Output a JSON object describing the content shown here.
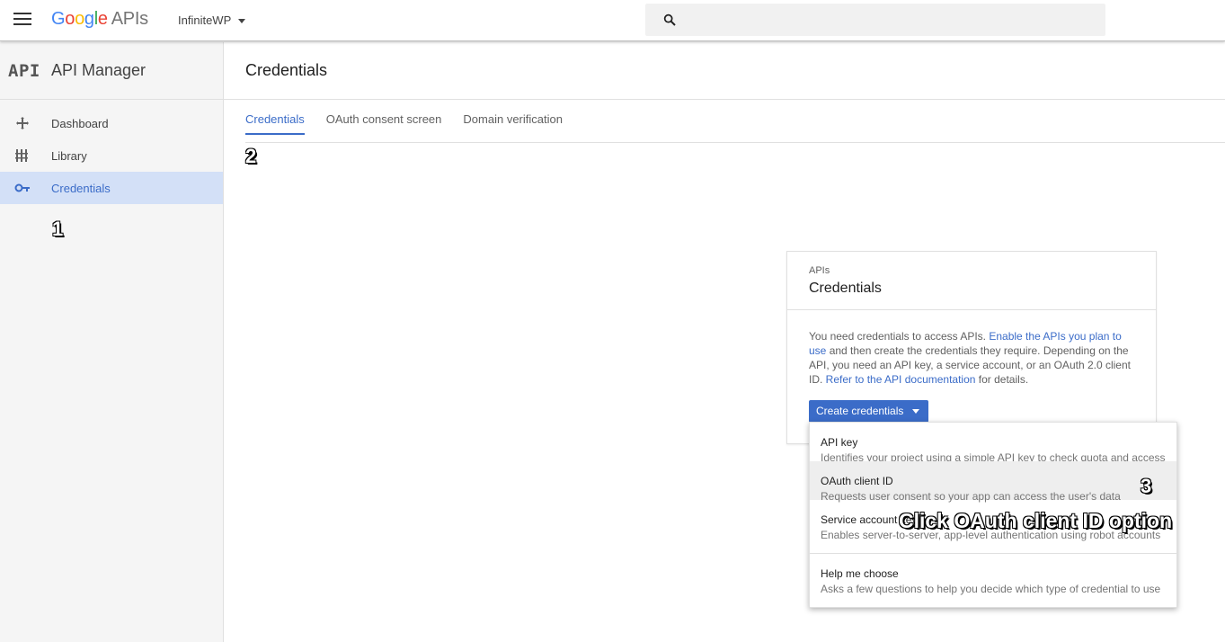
{
  "header": {
    "logo_text": "Google",
    "logo_product": "APIs",
    "project": "InfiniteWP",
    "search_placeholder": ""
  },
  "sidebar": {
    "badge": "API",
    "title": "API Manager",
    "items": [
      {
        "label": "Dashboard",
        "icon": "dashboard-icon"
      },
      {
        "label": "Library",
        "icon": "library-icon"
      },
      {
        "label": "Credentials",
        "icon": "key-icon",
        "active": true
      }
    ]
  },
  "main": {
    "title": "Credentials",
    "tabs": [
      {
        "label": "Credentials",
        "active": true
      },
      {
        "label": "OAuth consent screen"
      },
      {
        "label": "Domain verification"
      }
    ]
  },
  "card": {
    "eyebrow": "APIs",
    "title": "Credentials",
    "body_part1": "You need credentials to access APIs. ",
    "link1": "Enable the APIs you plan to use",
    "body_part2": " and then create the credentials they require. Depending on the API, you need an API key, a service account, or an OAuth 2.0 client ID. ",
    "link2": "Refer to the API documentation",
    "body_part3": " for details.",
    "button": "Create credentials"
  },
  "dropdown": {
    "items": [
      {
        "title": "API key",
        "desc": "Identifies your project using a simple API key to check quota and access"
      },
      {
        "title": "OAuth client ID",
        "desc": "Requests user consent so your app can access the user's data"
      },
      {
        "title": "Service account key",
        "desc": "Enables server-to-server, app-level authentication using robot accounts"
      },
      {
        "title": "Help me choose",
        "desc": "Asks a few questions to help you decide which type of credential to use"
      }
    ]
  },
  "annotations": {
    "step1": "1",
    "step2": "2",
    "step3": "3",
    "callout": "Click OAuth client ID option"
  },
  "colors": {
    "accent": "#3b6cc8",
    "active_nav_bg": "#d3e0f7"
  }
}
